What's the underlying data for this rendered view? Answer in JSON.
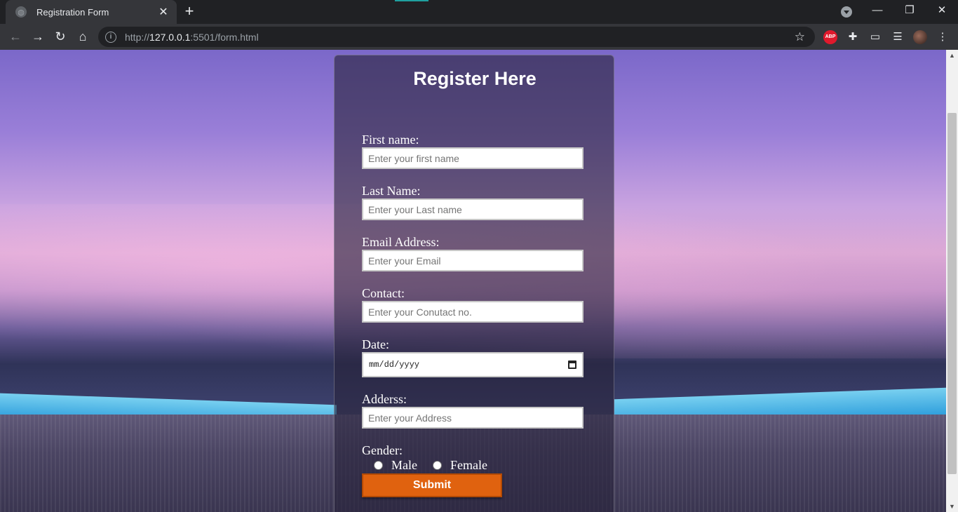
{
  "browser": {
    "tab_title": "Registration Form",
    "tab_close": "✕",
    "new_tab": "+",
    "url_scheme": "http://",
    "url_host": "127.0.0.1",
    "url_rest": ":5501/form.html",
    "abp_label": "ABP",
    "win_minimize": "—",
    "win_restore": "❐",
    "win_close": "✕"
  },
  "form": {
    "title": "Register Here",
    "fields": [
      {
        "label": "First name:",
        "placeholder": "Enter your first name"
      },
      {
        "label": "Last Name:",
        "placeholder": "Enter your Last name"
      },
      {
        "label": "Email Address:",
        "placeholder": "Enter your Email"
      },
      {
        "label": "Contact:",
        "placeholder": "Enter your Conutact no."
      }
    ],
    "date": {
      "label": "Date:",
      "value": "mm/dd/yyyy"
    },
    "address": {
      "label": "Adderss:",
      "placeholder": "Enter your Address"
    },
    "gender": {
      "label": "Gender:",
      "options": [
        "Male",
        "Female"
      ]
    },
    "submit_label": "Submit",
    "accent_color": "#e0620f"
  }
}
